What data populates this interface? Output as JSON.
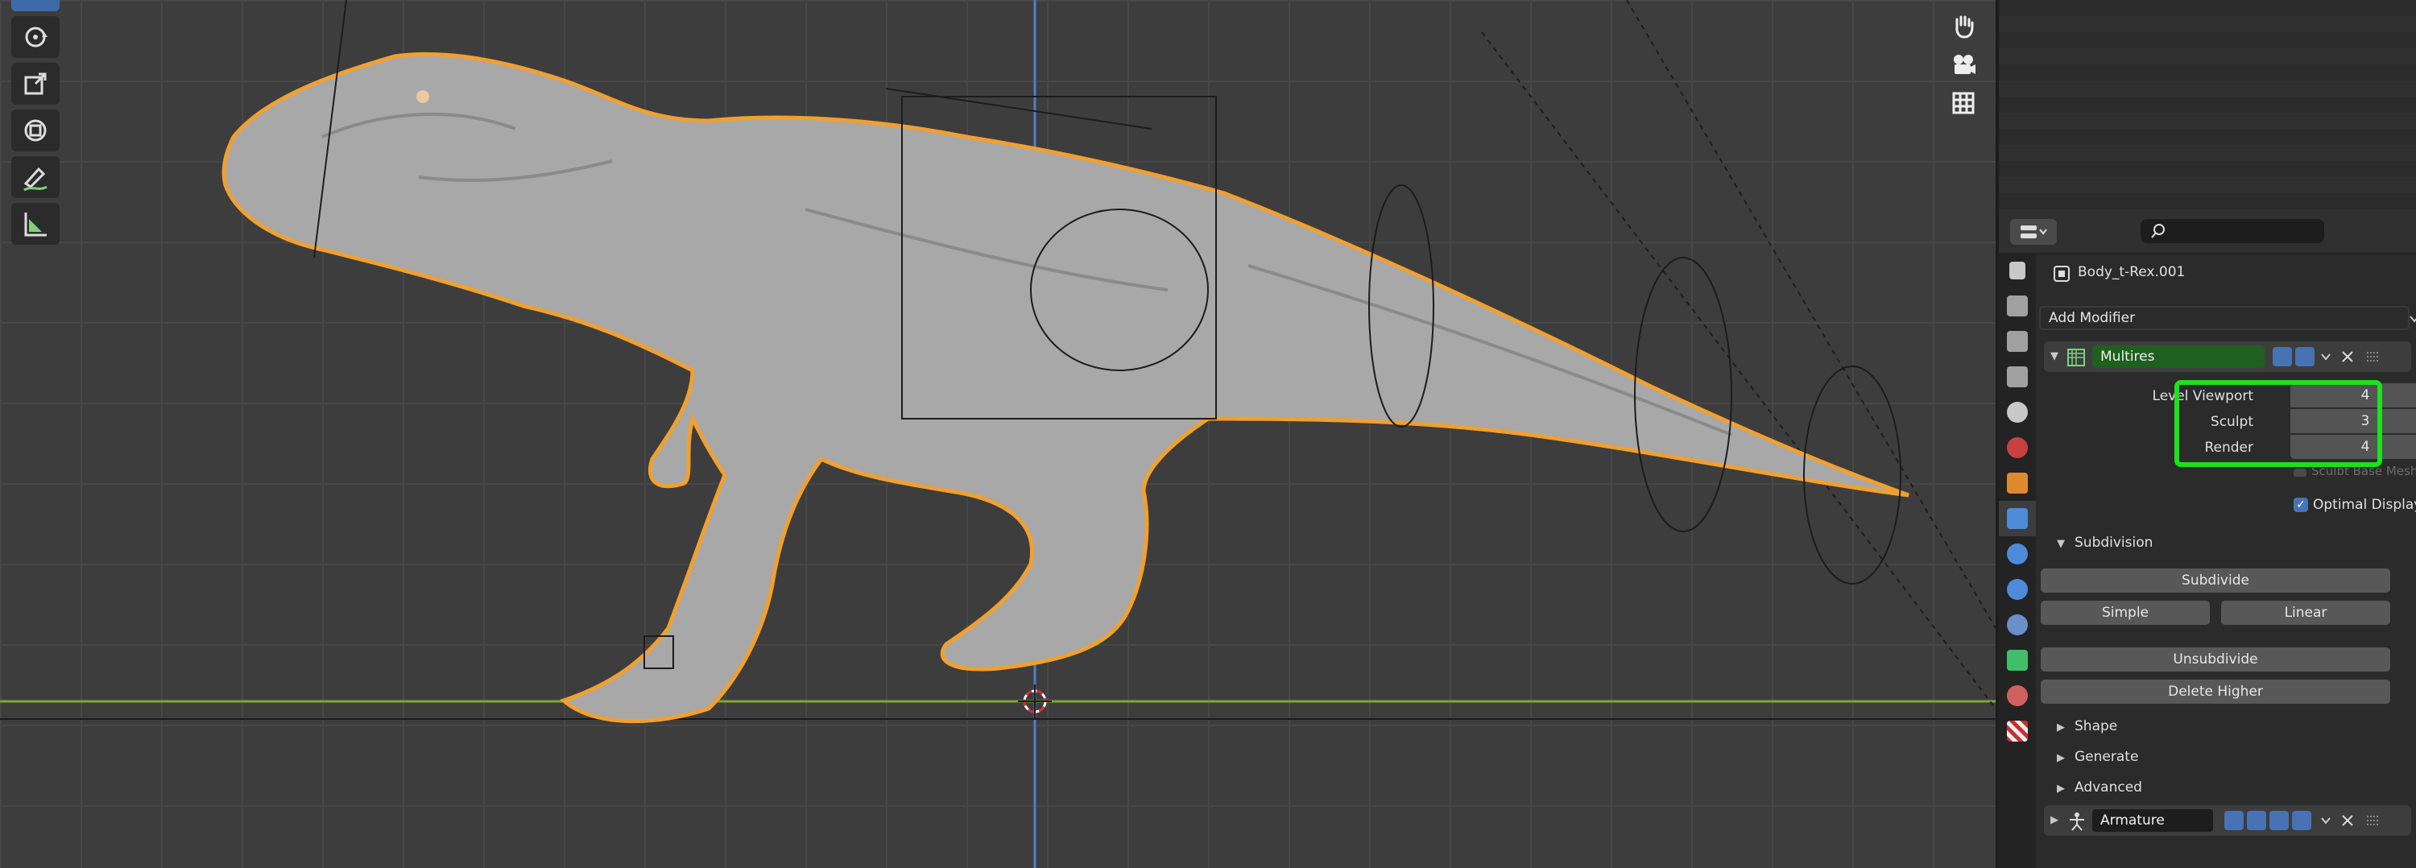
{
  "object_name": "Body_t-Rex.001",
  "add_modifier_label": "Add Modifier",
  "multires": {
    "name": "Multires",
    "level_viewport_label": "Level Viewport",
    "level_viewport_value": "4",
    "sculpt_label": "Sculpt",
    "sculpt_value": "3",
    "render_label": "Render",
    "render_value": "4",
    "sculpt_base_mesh_label": "Sculpt Base Mesh",
    "optimal_display_label": "Optimal Display",
    "optimal_display_checked": true
  },
  "subdivision": {
    "title": "Subdivision",
    "subdivide_label": "Subdivide",
    "simple_label": "Simple",
    "linear_label": "Linear",
    "unsubdivide_label": "Unsubdivide",
    "delete_higher_label": "Delete Higher"
  },
  "subpanels": [
    "Shape",
    "Generate",
    "Advanced"
  ],
  "armature": {
    "name": "Armature"
  },
  "colors": {
    "selection_outline": "#f0a030",
    "highlight_box": "#1ee01e",
    "modifier_name_bg": "#1f5f1f",
    "accent_blue": "#4772b3"
  },
  "icons": {
    "left_toolbar": [
      "rotate-icon",
      "scale-icon",
      "transform-icon",
      "annotate-icon",
      "measure-icon"
    ],
    "viewport_gizmos": [
      "hand-icon",
      "camera-icon",
      "grid-icon"
    ]
  }
}
